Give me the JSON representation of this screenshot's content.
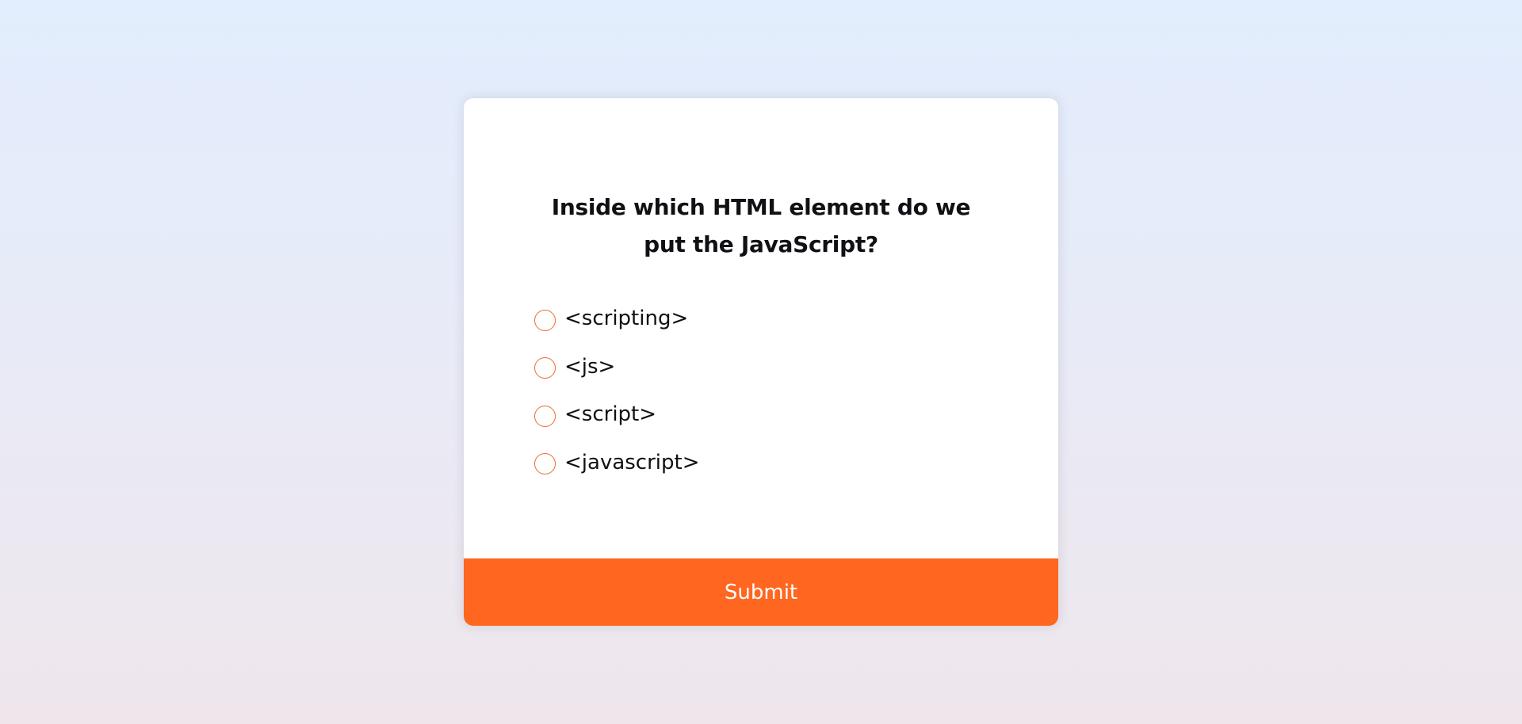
{
  "quiz": {
    "question": "Inside which HTML element do we put the JavaScript?",
    "options": [
      {
        "label": "<scripting>"
      },
      {
        "label": "<js>"
      },
      {
        "label": "<script>"
      },
      {
        "label": "<javascript>"
      }
    ],
    "submit_label": "Submit"
  },
  "colors": {
    "accent": "#ff6620",
    "radio_border": "#f06a2a",
    "text": "#121015",
    "card": "#ffffff",
    "background_top": "#e2edfd",
    "background_bottom": "#efe6ec"
  }
}
